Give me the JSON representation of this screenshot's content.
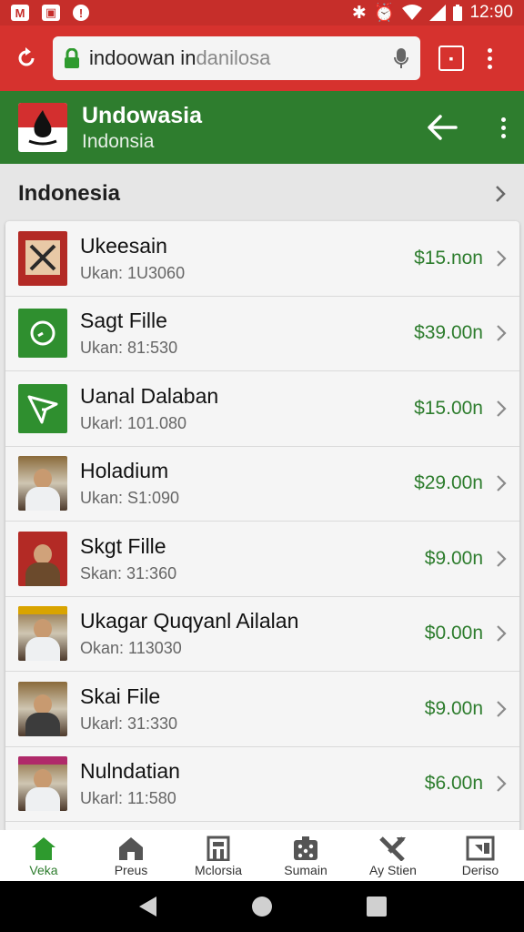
{
  "status_bar": {
    "left_icons": [
      "gmail-icon",
      "photo-icon",
      "alert-icon"
    ],
    "time": "12:90"
  },
  "browser": {
    "url_main": "indoowan in",
    "url_dim": "danilosa"
  },
  "app_bar": {
    "title": "Undowasia",
    "subtitle": "Indonsia"
  },
  "section": {
    "title": "Indonesia"
  },
  "items": [
    {
      "title": "Ukeesain",
      "sub": "Ukan: 1U3060",
      "price": "$15.non",
      "thumb": "poster"
    },
    {
      "title": "Sagt Fille",
      "sub": "Ukan: 81:530",
      "price": "$39.00n",
      "thumb": "green-clock"
    },
    {
      "title": "Uanal Dalaban",
      "sub": "Ukarl: 101.080",
      "price": "$15.00n",
      "thumb": "green-arrow"
    },
    {
      "title": "Holadium",
      "sub": "Ukan: S1:090",
      "price": "$29.00n",
      "thumb": "photo"
    },
    {
      "title": "Skgt Fille",
      "sub": "Skan: 31:360",
      "price": "$9.00n",
      "thumb": "poster-photo"
    },
    {
      "title": "Ukagar Quqyanl Ailalan",
      "sub": "Okan: 113030",
      "price": "$0.00n",
      "thumb": "photo-banner"
    },
    {
      "title": "Skai File",
      "sub": "Ukarl: 31:330",
      "price": "$9.00n",
      "thumb": "photo-dark"
    },
    {
      "title": "Nulndatian",
      "sub": "Ukarl: 11:580",
      "price": "$6.00n",
      "thumb": "photo-banner"
    }
  ],
  "bottom_nav": [
    {
      "label": "Veka",
      "icon": "home-icon",
      "active": true
    },
    {
      "label": "Preus",
      "icon": "house-icon",
      "active": false
    },
    {
      "label": "Mclorsia",
      "icon": "building-icon",
      "active": false
    },
    {
      "label": "Sumain",
      "icon": "dice-icon",
      "active": false
    },
    {
      "label": "Ay Stien",
      "icon": "x-tools-icon",
      "active": false
    },
    {
      "label": "Deriso",
      "icon": "tv-icon",
      "active": false
    }
  ],
  "colors": {
    "browser_red": "#d6322e",
    "app_green": "#2e7d2e",
    "price_green": "#2e7d2e"
  }
}
